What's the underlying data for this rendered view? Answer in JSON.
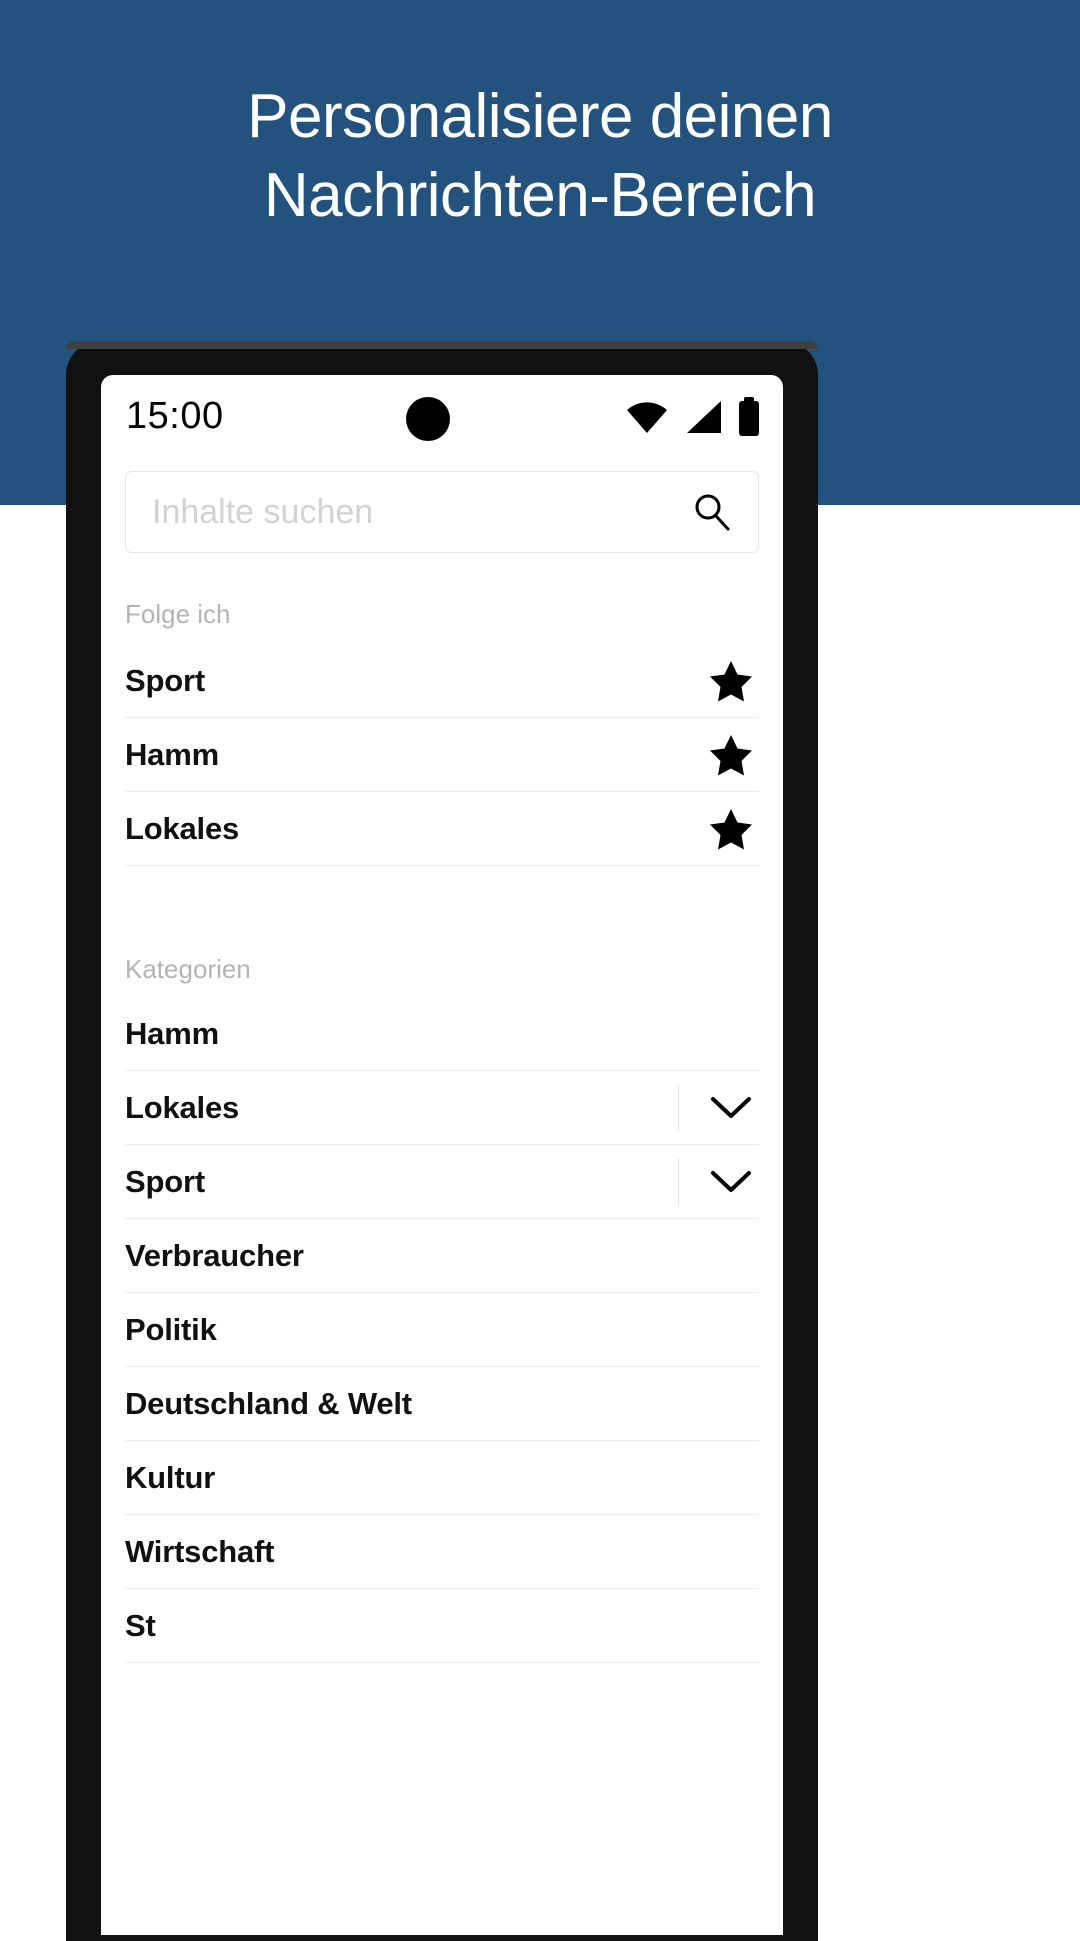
{
  "hero": {
    "title": "Personalisiere deinen\nNachrichten-Bereich",
    "background_color": "#24527e",
    "text_color": "#ffffff"
  },
  "phone": {
    "statusbar": {
      "time": "15:00",
      "icons": [
        "camera-punchhole",
        "wifi-icon",
        "signal-icon",
        "battery-icon"
      ]
    }
  },
  "search": {
    "placeholder": "Inhalte suchen",
    "value": "",
    "icon": "search-icon"
  },
  "following": {
    "section_label": "Folge ich",
    "items": [
      {
        "label": "Sport",
        "icon": "star-filled-icon"
      },
      {
        "label": "Hamm",
        "icon": "star-filled-icon"
      },
      {
        "label": "Lokales",
        "icon": "star-filled-icon"
      }
    ]
  },
  "categories": {
    "section_label": "Kategorien",
    "items": [
      {
        "label": "Hamm",
        "expandable": false
      },
      {
        "label": "Lokales",
        "expandable": true,
        "icon": "chevron-down-icon"
      },
      {
        "label": "Sport",
        "expandable": true,
        "icon": "chevron-down-icon"
      },
      {
        "label": "Verbraucher",
        "expandable": false
      },
      {
        "label": "Politik",
        "expandable": false
      },
      {
        "label": "Deutschland & Welt",
        "expandable": false
      },
      {
        "label": "Kultur",
        "expandable": false
      },
      {
        "label": "Wirtschaft",
        "expandable": false
      },
      {
        "label": "St",
        "expandable": false
      }
    ]
  }
}
